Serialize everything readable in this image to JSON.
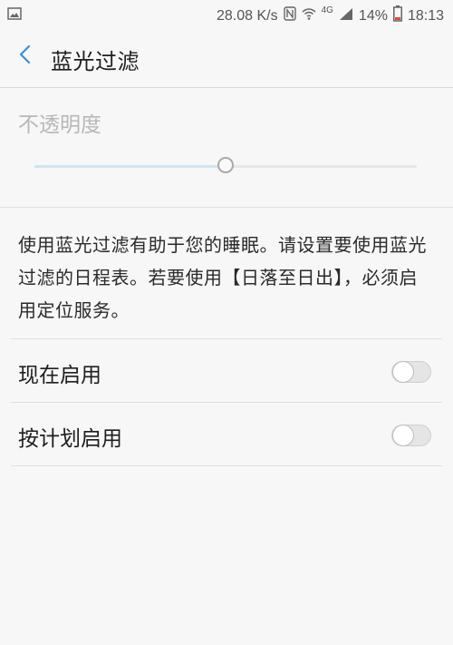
{
  "status_bar": {
    "net_speed": "28.08 K/s",
    "network_type": "4G",
    "battery": "14%",
    "time": "18:13",
    "icons": [
      "image-icon",
      "nfc-icon",
      "wifi-icon",
      "signal-icon",
      "battery-icon"
    ],
    "battery_color": "#e24a3a"
  },
  "header": {
    "title": "蓝光过滤",
    "back_icon": "chevron-left-icon",
    "accent_color": "#3b8fd3"
  },
  "opacity": {
    "label": "不透明度",
    "value_fraction": 0.5
  },
  "description": "使用蓝光过滤有助于您的睡眠。请设置要使用蓝光过滤的日程表。若要使用【日落至日出】，必须启用定位服务。",
  "settings": [
    {
      "label": "现在启用",
      "enabled": false
    },
    {
      "label": "按计划启用",
      "enabled": false
    }
  ]
}
